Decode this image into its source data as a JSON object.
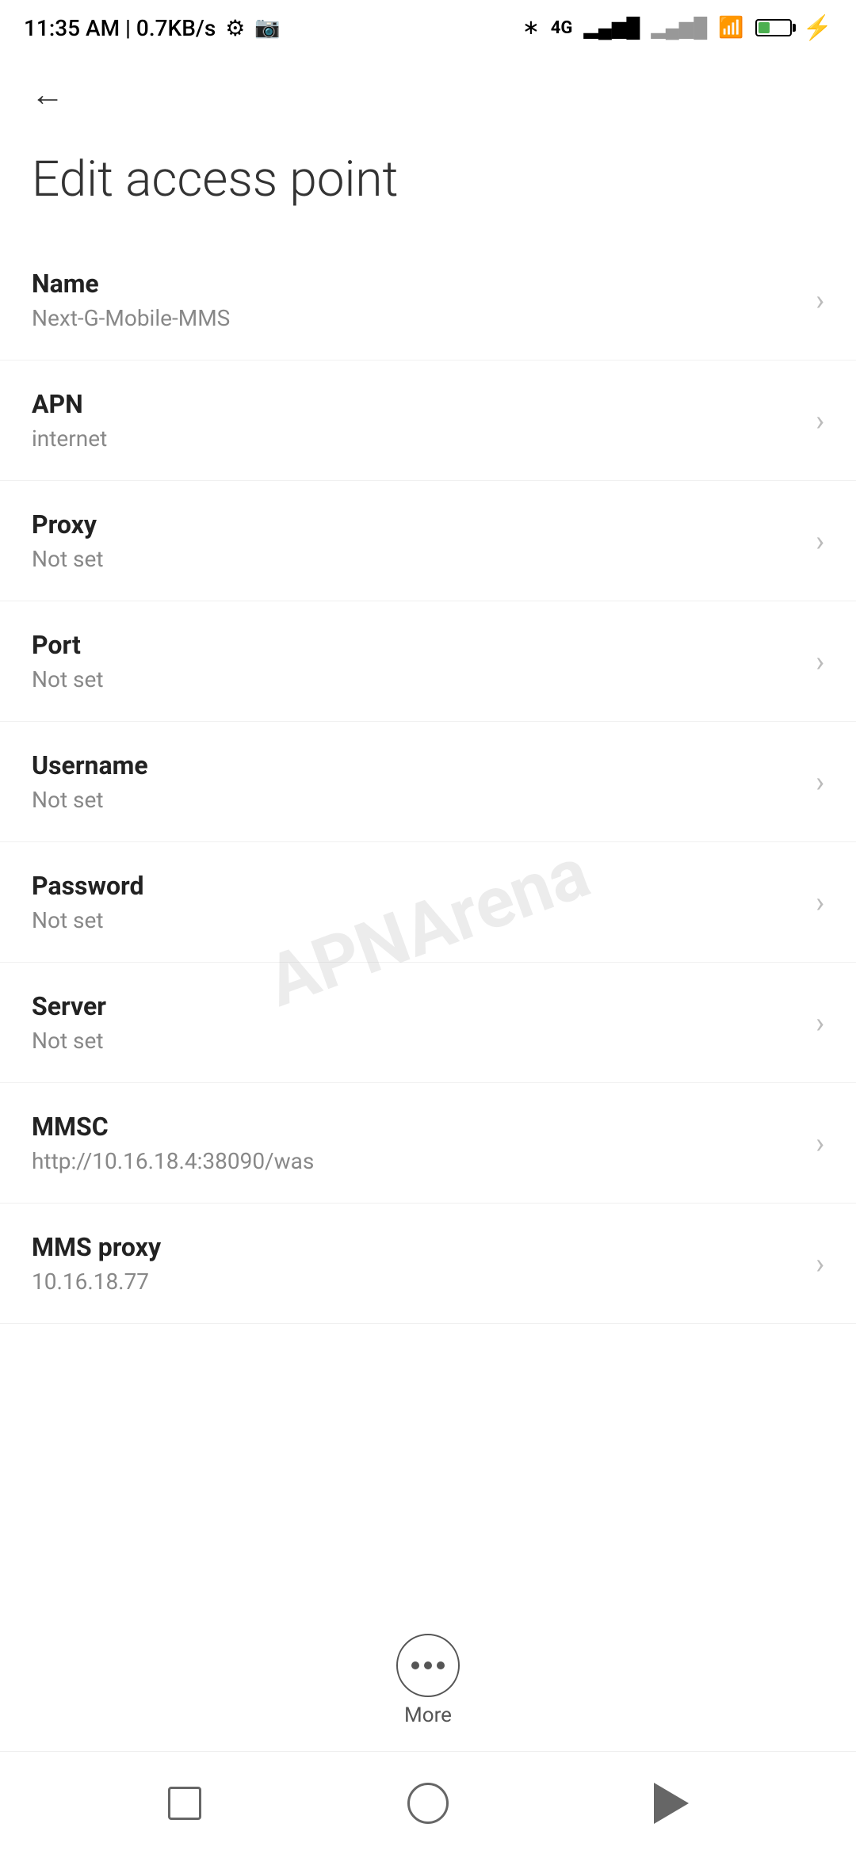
{
  "statusBar": {
    "time": "11:35 AM | 0.7KB/s",
    "batteryPercent": "38"
  },
  "toolbar": {
    "backLabel": "←"
  },
  "page": {
    "title": "Edit access point"
  },
  "settings": {
    "items": [
      {
        "title": "Name",
        "subtitle": "Next-G-Mobile-MMS"
      },
      {
        "title": "APN",
        "subtitle": "internet"
      },
      {
        "title": "Proxy",
        "subtitle": "Not set"
      },
      {
        "title": "Port",
        "subtitle": "Not set"
      },
      {
        "title": "Username",
        "subtitle": "Not set"
      },
      {
        "title": "Password",
        "subtitle": "Not set"
      },
      {
        "title": "Server",
        "subtitle": "Not set"
      },
      {
        "title": "MMSC",
        "subtitle": "http://10.16.18.4:38090/was"
      },
      {
        "title": "MMS proxy",
        "subtitle": "10.16.18.77"
      }
    ]
  },
  "more": {
    "label": "More"
  },
  "watermark": "APNArena"
}
